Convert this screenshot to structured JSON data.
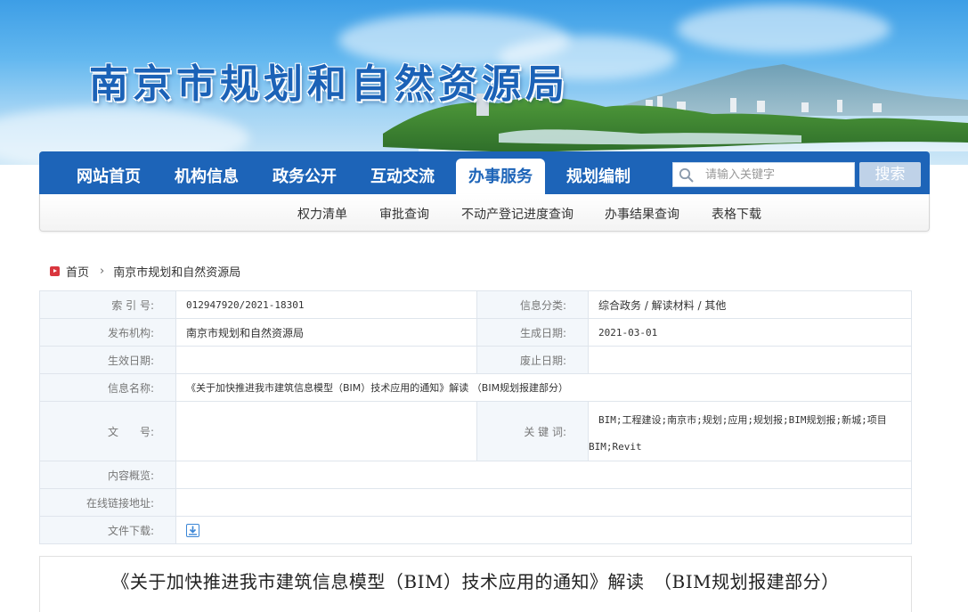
{
  "header": {
    "site_title": "南京市规划和自然资源局"
  },
  "nav": {
    "items": [
      {
        "label": "网站首页",
        "active": false
      },
      {
        "label": "机构信息",
        "active": false
      },
      {
        "label": "政务公开",
        "active": false
      },
      {
        "label": "互动交流",
        "active": false
      },
      {
        "label": "办事服务",
        "active": true
      },
      {
        "label": "规划编制",
        "active": false
      }
    ],
    "search_placeholder": "请输入关键字",
    "search_button": "搜索",
    "search_icon": "search-icon"
  },
  "subnav": {
    "items": [
      "权力清单",
      "审批查询",
      "不动产登记进度查询",
      "办事结果查询",
      "表格下载"
    ]
  },
  "breadcrumb": {
    "home": "首页",
    "separator": "›",
    "current": "南京市规划和自然资源局"
  },
  "info": {
    "index_label": "索 引 号:",
    "index_value": "012947920/2021-18301",
    "category_label": "信息分类:",
    "category_value": "综合政务 / 解读材料 / 其他",
    "publisher_label": "发布机构:",
    "publisher_value": "南京市规划和自然资源局",
    "created_label": "生成日期:",
    "created_value": "2021-03-01",
    "effective_label": "生效日期:",
    "effective_value": "",
    "expire_label": "废止日期:",
    "expire_value": "",
    "name_label": "信息名称:",
    "name_value": "《关于加快推进我市建筑信息模型（BIM）技术应用的通知》解读 （BIM规划报建部分）",
    "docno_label": "文　　号:",
    "docno_value": "",
    "keywords_label": "关 键 词:",
    "keywords_line1": "BIM;工程建设;南京市;规划;应用;规划报;BIM规划报;新城;项目",
    "keywords_line2": "BIM;Revit",
    "summary_label": "内容概览:",
    "summary_value": "",
    "link_label": "在线链接地址:",
    "link_value": "",
    "download_label": "文件下载:",
    "download_icon": "download-icon"
  },
  "article": {
    "title": "《关于加快推进我市建筑信息模型（BIM）技术应用的通知》解读　（BIM规划报建部分）"
  },
  "colors": {
    "nav_blue": "#1d64b8",
    "label_bg": "#f3f7fb",
    "border": "#dfe5ec"
  }
}
